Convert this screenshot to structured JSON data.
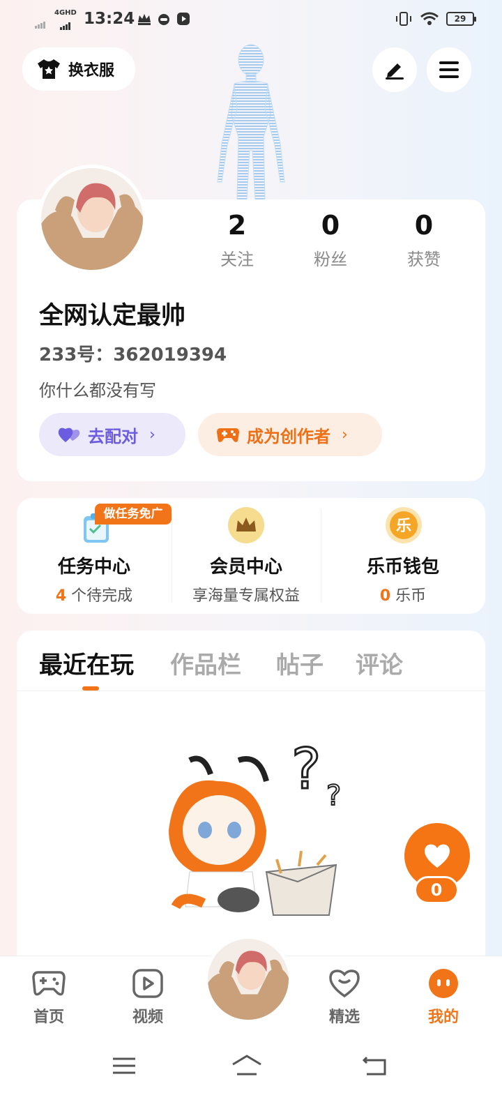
{
  "status_bar": {
    "network": "4GHD",
    "time": "13:24",
    "battery": "29"
  },
  "header": {
    "outfit_label": "换衣服",
    "edit_icon": "pen-icon",
    "menu_icon": "hamburger-menu-icon"
  },
  "profile": {
    "stats": [
      {
        "value": "2",
        "label": "关注"
      },
      {
        "value": "0",
        "label": "粉丝"
      },
      {
        "value": "0",
        "label": "获赞"
      }
    ],
    "nickname": "全网认定最帅",
    "uid": "233号：362019394",
    "bio": "你什么都没有写",
    "pair_button": "去配对",
    "creator_button": "成为创作者"
  },
  "services": {
    "task": {
      "title": "任务中心",
      "count": "4",
      "suffix": "个待完成",
      "badge": "做任务免广告"
    },
    "vip": {
      "title": "会员中心",
      "sub": "享海量专属权益"
    },
    "wallet": {
      "title": "乐币钱包",
      "count": "0",
      "suffix": "乐币",
      "coin_char": "乐"
    }
  },
  "tabs": [
    "最近在玩",
    "作品栏",
    "帖子",
    "评论"
  ],
  "active_tab": 0,
  "float_like": {
    "count": "0"
  },
  "bottom_nav": [
    {
      "label": "首页",
      "icon": "gamepad-icon"
    },
    {
      "label": "视频",
      "icon": "play-icon"
    },
    {
      "label": "精选",
      "icon": "heart-chat-icon"
    },
    {
      "label": "我的",
      "icon": "profile-face-icon"
    }
  ],
  "colors": {
    "accent": "#f27418",
    "pair_purple": "#6c5ce0"
  }
}
